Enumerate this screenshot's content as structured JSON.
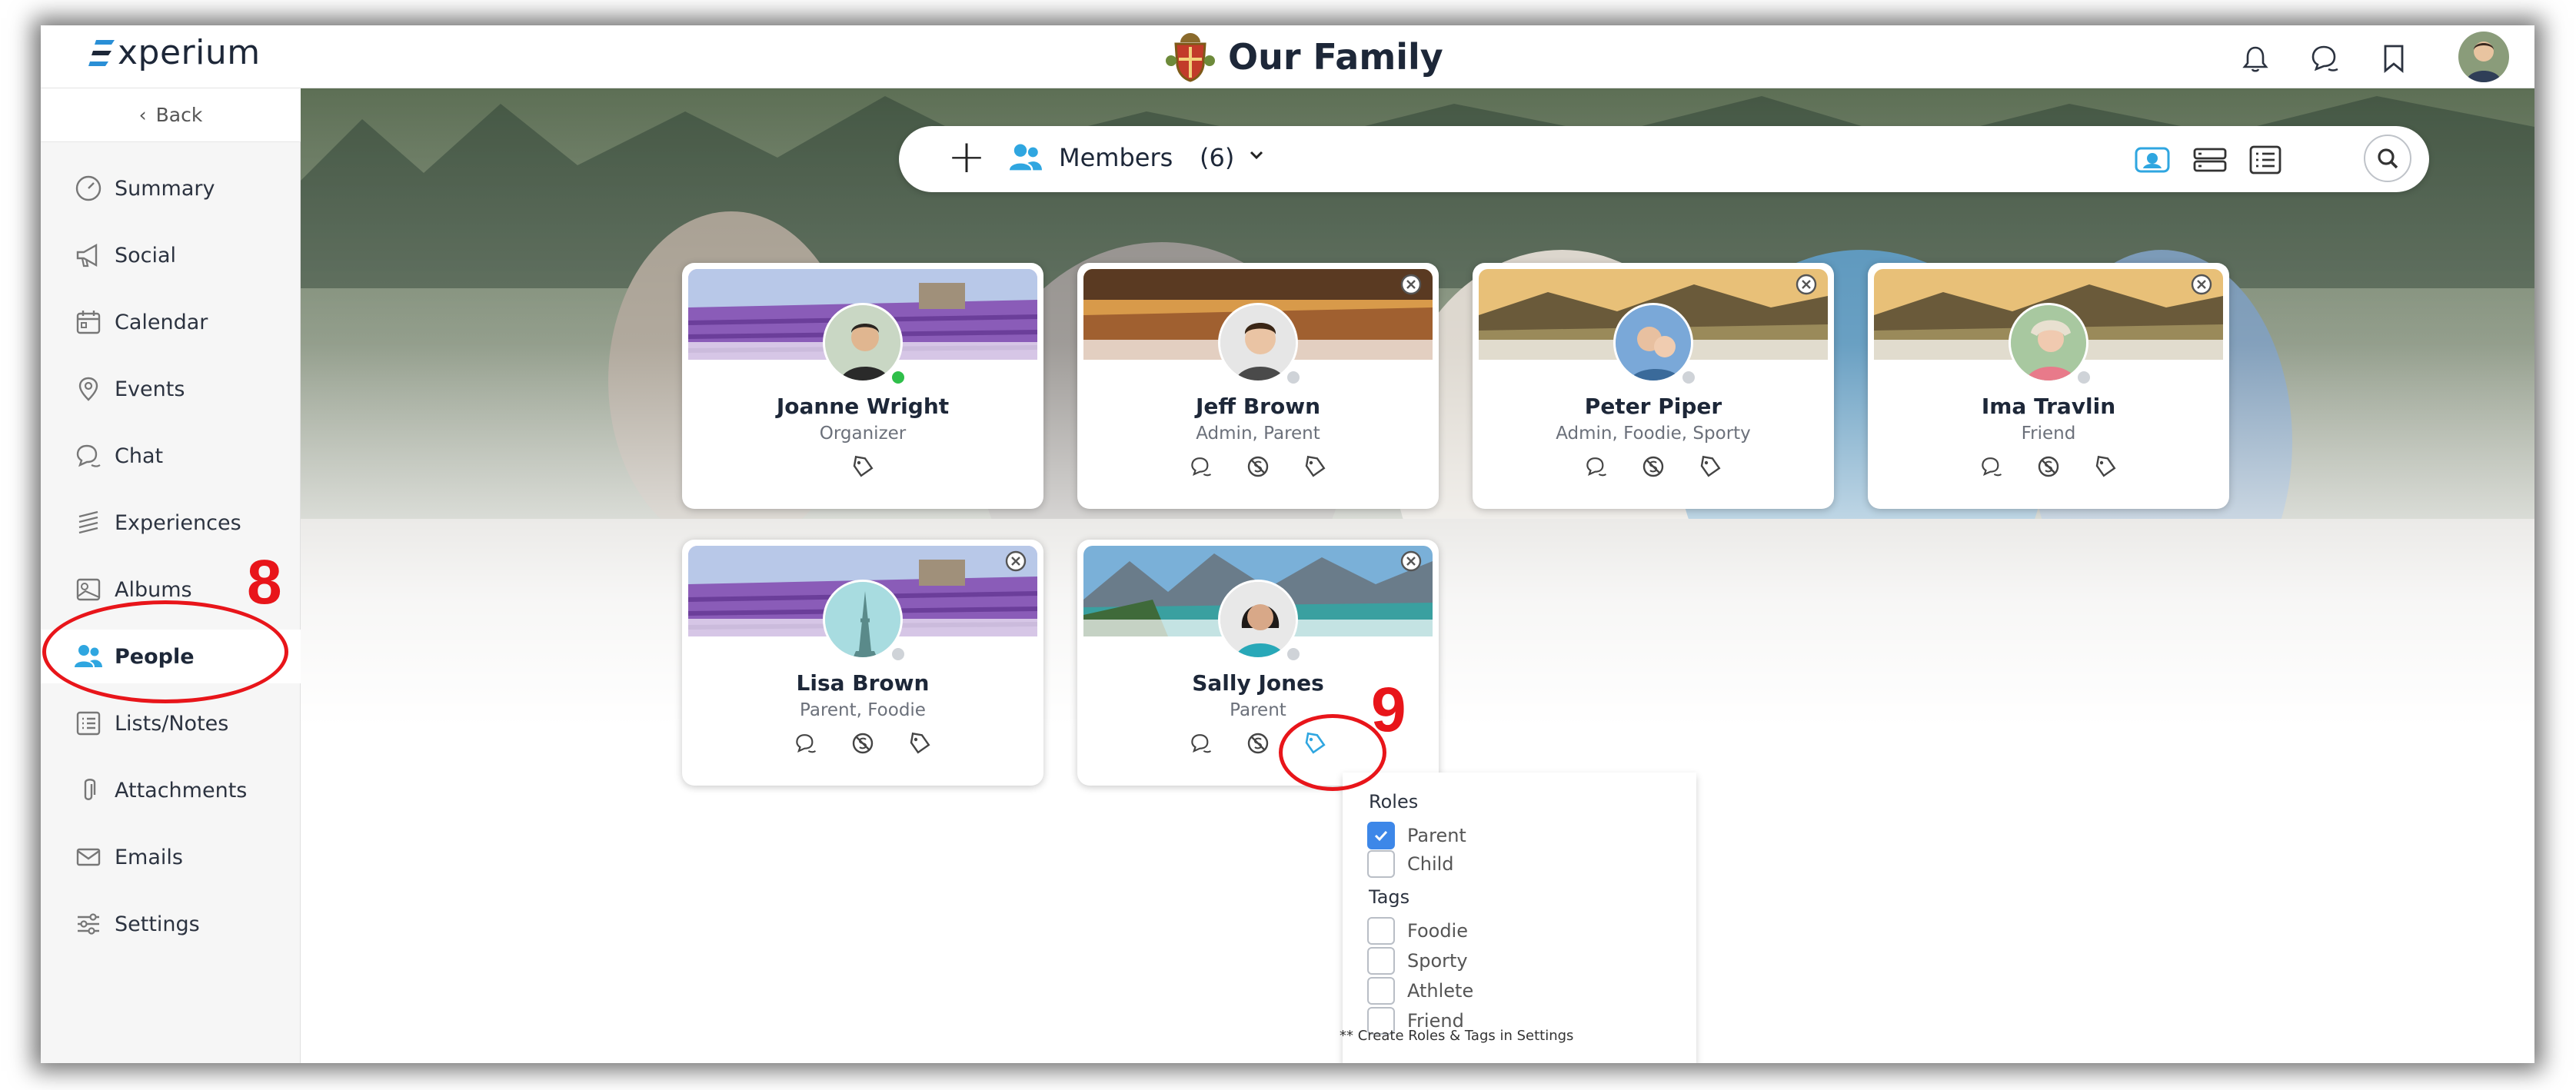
{
  "app": {
    "logo": "Experium",
    "logo_text": "xperium",
    "title": "Our Family"
  },
  "header": {
    "icons": [
      "bell-icon",
      "chat-icon",
      "bookmark-icon",
      "avatar"
    ]
  },
  "sidebar": {
    "back_label": "Back",
    "items": [
      {
        "label": "Summary",
        "icon": "gauge-icon"
      },
      {
        "label": "Social",
        "icon": "megaphone-icon"
      },
      {
        "label": "Calendar",
        "icon": "calendar-icon"
      },
      {
        "label": "Events",
        "icon": "location-icon"
      },
      {
        "label": "Chat",
        "icon": "chat-icon"
      },
      {
        "label": "Experiences",
        "icon": "layers-icon"
      },
      {
        "label": "Albums",
        "icon": "image-icon"
      },
      {
        "label": "People",
        "icon": "people-icon",
        "active": true
      },
      {
        "label": "Lists/Notes",
        "icon": "list-icon"
      },
      {
        "label": "Attachments",
        "icon": "paperclip-icon"
      },
      {
        "label": "Emails",
        "icon": "mail-icon"
      },
      {
        "label": "Settings",
        "icon": "sliders-icon"
      }
    ]
  },
  "toolbar": {
    "add_label": "+",
    "members_label": "Members",
    "count": "(6)"
  },
  "members": [
    {
      "name": "Joanne Wright",
      "role": "Organizer",
      "status_color": "#2fbf4a"
    },
    {
      "name": "Jeff Brown",
      "role": "Admin, Parent",
      "status_color": "#cfd3d8"
    },
    {
      "name": "Peter Piper",
      "role": "Admin, Foodie, Sporty",
      "status_color": "#cfd3d8"
    },
    {
      "name": "Ima Travlin",
      "role": "Friend",
      "status_color": "#cfd3d8"
    },
    {
      "name": "Lisa Brown",
      "role": "Parent, Foodie",
      "status_color": "#cfd3d8"
    },
    {
      "name": "Sally Jones",
      "role": "Parent",
      "status_color": "#cfd3d8"
    }
  ],
  "dropdown": {
    "roles_heading": "Roles",
    "roles": [
      {
        "label": "Parent",
        "checked": true
      },
      {
        "label": "Child",
        "checked": false
      }
    ],
    "tags_heading": "Tags",
    "tags": [
      {
        "label": "Foodie",
        "checked": false
      },
      {
        "label": "Sporty",
        "checked": false
      },
      {
        "label": "Athlete",
        "checked": false
      },
      {
        "label": "Friend",
        "checked": false
      }
    ],
    "note": "** Create Roles & Tags in Settings"
  },
  "annotations": {
    "step_8": "8",
    "step_9": "9"
  },
  "colors": {
    "accent": "#2fa6e0",
    "annotation": "#e8151a",
    "checkbox": "#3d87e8"
  }
}
